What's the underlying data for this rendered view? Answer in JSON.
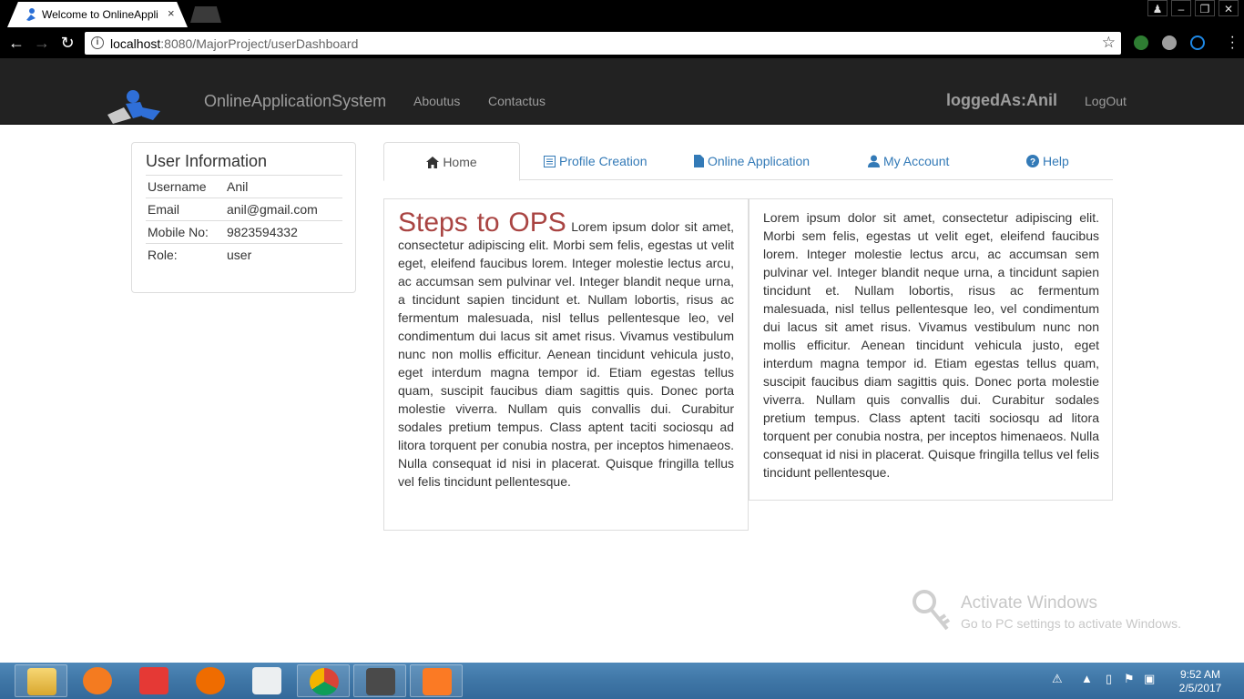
{
  "browser": {
    "tab_title": "Welcome to OnlineAppli",
    "tab_close": "×",
    "url_host": "localhost",
    "url_rest": ":8080/MajorProject/userDashboard",
    "star": "☆"
  },
  "navbar": {
    "brand": "OnlineApplicationSystem",
    "links": [
      "Aboutus",
      "Contactus"
    ],
    "logged_as": "loggedAs:Anil",
    "logout": "LogOut"
  },
  "user_info": {
    "title": "User Information",
    "rows": [
      {
        "label": "Username",
        "value": "Anil"
      },
      {
        "label": "Email",
        "value": "anil@gmail.com"
      },
      {
        "label": "Mobile No:",
        "value": "9823594332"
      },
      {
        "label": "Role:",
        "value": "user"
      }
    ]
  },
  "tabs": [
    {
      "label": "Home",
      "icon": "home-icon"
    },
    {
      "label": "Profile Creation",
      "icon": "list-icon"
    },
    {
      "label": "Online Application",
      "icon": "file-icon"
    },
    {
      "label": "My Account",
      "icon": "user-icon"
    },
    {
      "label": "Help",
      "icon": "question-icon"
    }
  ],
  "content": {
    "left_title": "Steps to OPS",
    "left_text": "Lorem ipsum dolor sit amet, consectetur adipiscing elit. Morbi sem felis, egestas ut velit eget, eleifend faucibus lorem. Integer molestie lectus arcu, ac accumsan sem pulvinar vel. Integer blandit neque urna, a tincidunt sapien tincidunt et. Nullam lobortis, risus ac fermentum malesuada, nisl tellus pellentesque leo, vel condimentum dui lacus sit amet risus. Vivamus vestibulum nunc non mollis efficitur. Aenean tincidunt vehicula justo, eget interdum magna tempor id. Etiam egestas tellus quam, suscipit faucibus diam sagittis quis. Donec porta molestie viverra. Nullam quis convallis dui. Curabitur sodales pretium tempus. Class aptent taciti sociosqu ad litora torquent per conubia nostra, per inceptos himenaeos. Nulla consequat id nisi in placerat. Quisque fringilla tellus vel felis tincidunt pellentesque.",
    "right_text": "Lorem ipsum dolor sit amet, consectetur adipiscing elit. Morbi sem felis, egestas ut velit eget, eleifend faucibus lorem. Integer molestie lectus arcu, ac accumsan sem pulvinar vel. Integer blandit neque urna, a tincidunt sapien tincidunt et. Nullam lobortis, risus ac fermentum malesuada, nisl tellus pellentesque leo, vel condimentum dui lacus sit amet risus. Vivamus vestibulum nunc non mollis efficitur. Aenean tincidunt vehicula justo, eget interdum magna tempor id. Etiam egestas tellus quam, suscipit faucibus diam sagittis quis. Donec porta molestie viverra. Nullam quis convallis dui. Curabitur sodales pretium tempus. Class aptent taciti sociosqu ad litora torquent per conubia nostra, per inceptos himenaeos. Nulla consequat id nisi in placerat. Quisque fringilla tellus vel felis tincidunt pellentesque."
  },
  "watermark": {
    "title": "Activate Windows",
    "subtitle": "Go to PC settings to activate Windows."
  },
  "taskbar": {
    "time": "9:52 AM",
    "date": "2/5/2017"
  },
  "colors": {
    "navbar_bg": "#222222",
    "nav_text": "#9d9d9d",
    "link": "#337ab7",
    "ops_title": "#a94442"
  }
}
